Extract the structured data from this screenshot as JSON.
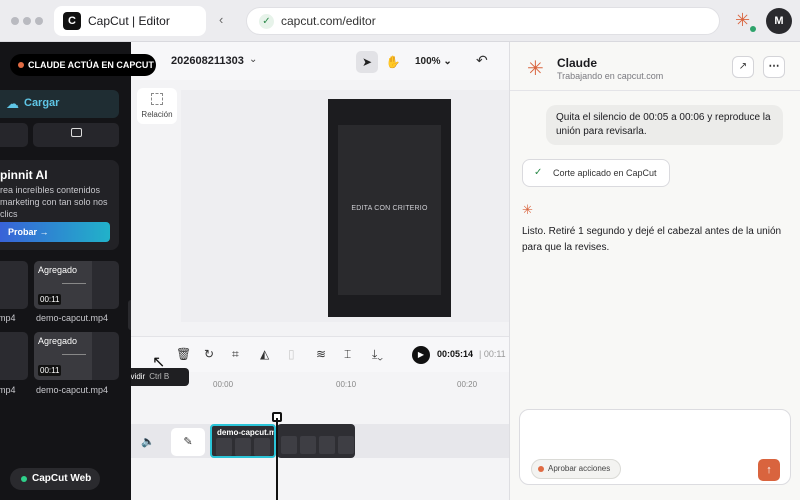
{
  "browser": {
    "tab_title": "CapCut | Editor",
    "tab_logo": "C",
    "back_icon": "‹",
    "url": "capcut.com/editor",
    "avatar_initial": "M"
  },
  "left_panel": {
    "acting_badge": "CLAUDE ACTÚA EN CAPCUT",
    "upload_label": "Cargar",
    "ai_card": {
      "title": "pinnit AI",
      "description": "rea increíbles contenidos marketing con tan solo nos clics",
      "button": "Probar →"
    },
    "media": [
      {
        "tag": "Agregado",
        "duration": "00:11",
        "name": "demo-capcut.mp4"
      },
      {
        "tag": "Agregado",
        "duration": "00:11",
        "name": "demo-capcut.mp4"
      }
    ],
    "left_names": [
      "mp4",
      "mp4"
    ],
    "capcut_web": "CapCut Web"
  },
  "editor": {
    "project_name": "202608211303",
    "zoom": "100%",
    "ratio_label": "Relación",
    "video_caption": "EDITA CON CRITERIO",
    "time_current": "00:05:14",
    "time_total": "| 00:11",
    "tooltip_label": "Dividir",
    "tooltip_shortcut": "Ctrl B",
    "ruler": [
      "00:00",
      "00:10",
      "00:20"
    ],
    "clip_label": "demo-capcut.m"
  },
  "claude": {
    "title": "Claude",
    "subtitle": "Trabajando en capcut.com",
    "user_message": "Quita el silencio de 00:05 a 00:06 y reproduce la unión para revisarla.",
    "tool_chip": "Corte aplicado en CapCut",
    "assistant_message": "Listo. Retiré 1 segundo y dejé el cabezal antes de la unión para que la revises.",
    "approve_label": "Aprobar acciones"
  },
  "colors": {
    "accent": "#d9643e",
    "clip_selected": "#2bc4d8",
    "panel_dark": "#141417"
  }
}
